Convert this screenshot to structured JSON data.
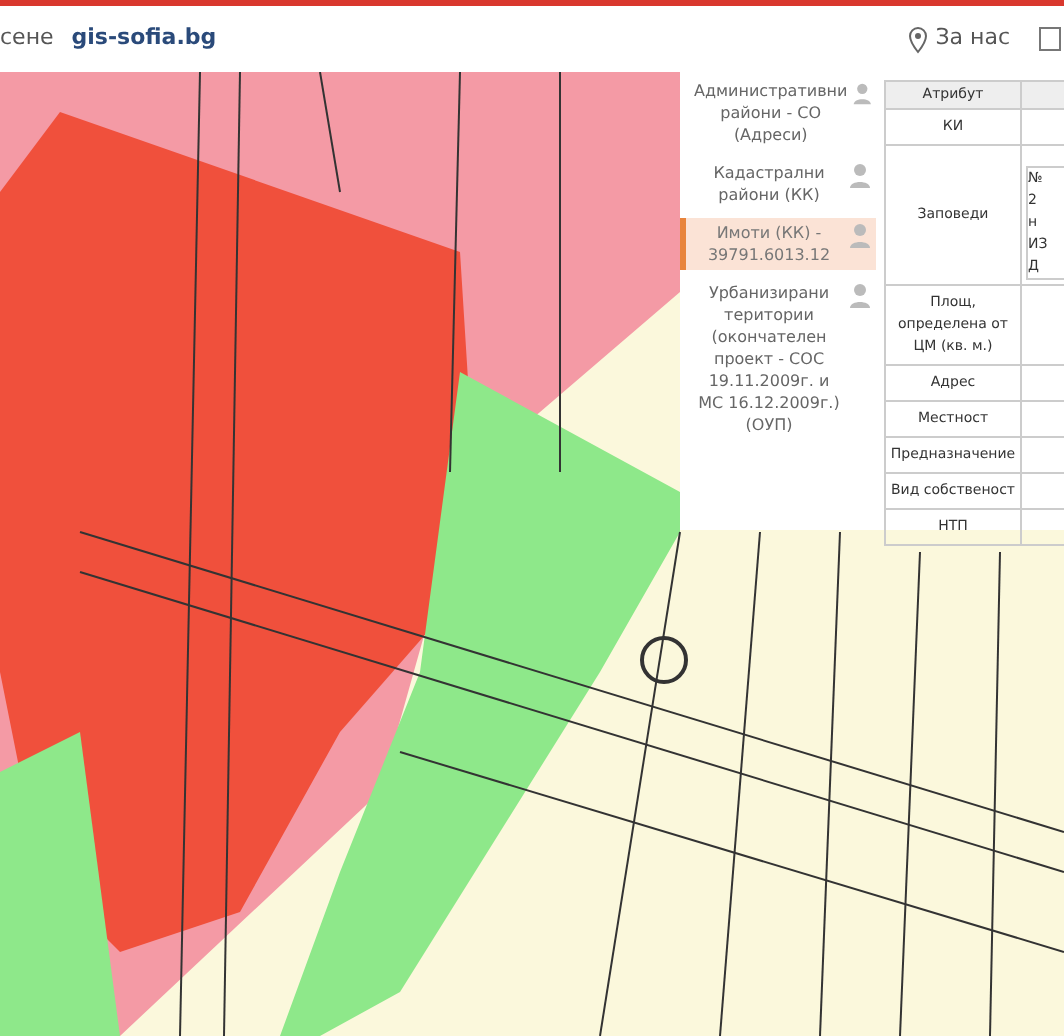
{
  "header": {
    "left_text": "сене",
    "site": "gis-sofia.bg",
    "about": "За нас"
  },
  "layers": [
    {
      "label": "Административни райони - СО (Адреси)",
      "selected": false
    },
    {
      "label": "Кадастрални райони (КК)",
      "selected": false
    },
    {
      "label": "Имоти (КК) - 39791.6013.12",
      "selected": true
    },
    {
      "label": "Урбанизирани територии (окончателен проект - СОС 19.11.2009г. и МС 16.12.2009г.) (ОУП)",
      "selected": false
    }
  ],
  "attributes": {
    "columns": [
      "Атрибут"
    ],
    "rows": [
      {
        "name": "КИ"
      },
      {
        "name": "Заповеди",
        "nested": [
          "№",
          "2",
          "н",
          "ИЗ",
          "Д"
        ]
      },
      {
        "name": "Площ, определена от ЦМ (кв. м.)"
      },
      {
        "name": "Адрес"
      },
      {
        "name": "Местност"
      },
      {
        "name": "Предназначение"
      },
      {
        "name": "Вид собственост"
      },
      {
        "name": "НТП"
      }
    ]
  }
}
